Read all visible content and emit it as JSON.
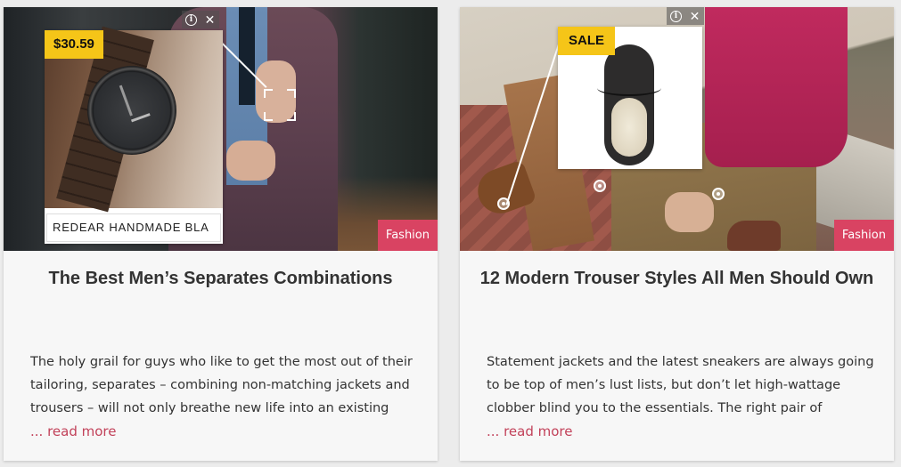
{
  "cards": [
    {
      "ad": {
        "price_badge": "$30.59",
        "caption": "REDEAR HANDMADE BLA",
        "info_icon": "info-icon",
        "close_icon": "close-icon"
      },
      "category": "Fashion",
      "title": "The Best Men’s Separates Combinations",
      "excerpt": "The holy grail for guys who like to get the most out of their tailoring, separates – combining non-matching jackets and trousers – will not only breathe new life into an existing",
      "read_more": "... read more"
    },
    {
      "ad": {
        "price_badge": "SALE",
        "info_icon": "info-icon",
        "close_icon": "close-icon"
      },
      "category": "Fashion",
      "title": "12 Modern Trouser Styles All Men Should Own",
      "excerpt": "Statement jackets and the latest sneakers are always going to be top of men’s lust lists, but don’t let high-wattage clobber blind you to the essentials. The right pair of",
      "read_more": "... read more"
    }
  ],
  "colors": {
    "badge": "#f5c518",
    "category": "#d94362",
    "read_more": "#c2425a"
  }
}
